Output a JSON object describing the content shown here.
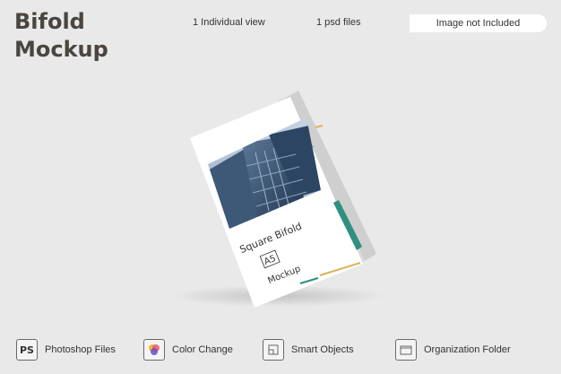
{
  "header": {
    "title_line1": "Bifold",
    "title_line2": "Mockup",
    "views": "1 Individual view",
    "files": "1 psd files",
    "image_note": "Image not Included"
  },
  "brochure": {
    "heading": "Square Bifold",
    "size_label": "A5",
    "subheading": "Mockup",
    "colors": {
      "teal": "#2f8f80",
      "gold": "#d8b45a"
    }
  },
  "features": [
    {
      "icon": "ps-icon",
      "icon_text": "PS",
      "label": "Photoshop Files"
    },
    {
      "icon": "color-change-icon",
      "icon_text": "",
      "label": "Color Change"
    },
    {
      "icon": "smart-objects-icon",
      "icon_text": "",
      "label": "Smart Objects"
    },
    {
      "icon": "folder-icon",
      "icon_text": "",
      "label": "Organization Folder"
    }
  ]
}
